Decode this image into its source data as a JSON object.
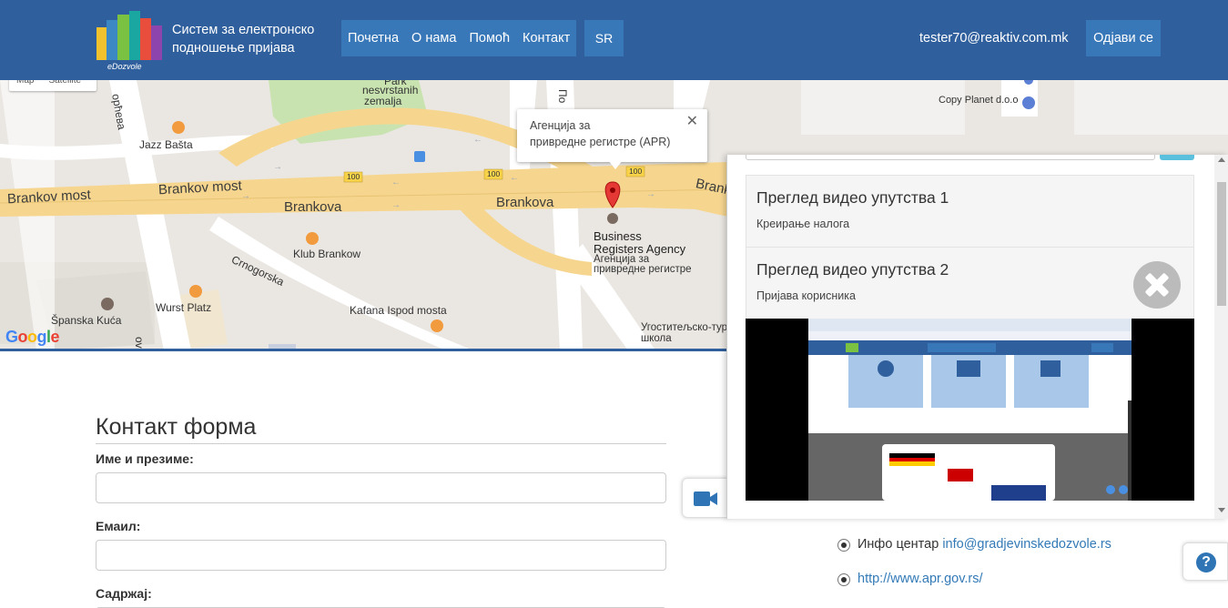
{
  "header": {
    "logo_text": "eDozvole",
    "title_line1": "Систем за електронско",
    "title_line2": "подношење пријава",
    "nav": [
      "Почетна",
      "О нама",
      "Помоћ",
      "Контакт"
    ],
    "language": "SR",
    "user_email": "tester70@reaktiv.com.mk",
    "logout": "Одјави се"
  },
  "map": {
    "map_type": [
      "Map",
      "Satellite"
    ],
    "info_window": {
      "line1": "Агенција за",
      "line2": "привредне регистре (APR)"
    },
    "labels": {
      "park1": "Park",
      "park2": "nesvrstanih",
      "park3": "zemalja",
      "jazz": "Jazz Bašta",
      "brankov_most1": "Brankov most",
      "brankov_most2": "Brankov most",
      "brankova1": "Brankova",
      "brankova2": "Brankova",
      "brank": "Brank",
      "bra1": "Business",
      "bra2": "Registers Agency",
      "bra3": "Агенција за",
      "bra4": "привредне регистре",
      "klub": "Klub Brankow",
      "crnogorska": "Crnogorska",
      "wurst": "Wurst Platz",
      "spanska": "Španska Kuća",
      "kafana": "Kafana Ispod mosta",
      "ugostitelj1": "Угоститељско-тури",
      "ugostitelj2": "школа",
      "copy_planet": "Copy Planet d.o.o",
      "road_100": "100",
      "orcheva": "орћева",
      "ovic": "ović",
      "po": "По"
    },
    "google": "Google"
  },
  "contact_form": {
    "title": "Контакт форма",
    "name_label": "Име и презиме:",
    "email_label": "Емаил:",
    "content_label": "Садржај:"
  },
  "contact_links": {
    "info_prefix": "Инфо центар",
    "info_email": "info@gradjevinskedozvole.rs",
    "apr_url": "http://www.apr.gov.rs/"
  },
  "video_panel": {
    "items": [
      {
        "title": "Преглед видео упутства 1",
        "subtitle": "Креирање налога"
      },
      {
        "title": "Преглед видео упутства 2",
        "subtitle": "Пријава корисника"
      }
    ]
  },
  "colors": {
    "header_bg": "#2f5f9c",
    "nav_bg": "#3877b8",
    "link": "#337ab7",
    "map_road": "#f6d68f"
  },
  "icons": {
    "camera": "video-camera-icon",
    "help": "question-icon",
    "close": "close-icon",
    "marker": "map-marker-icon"
  }
}
